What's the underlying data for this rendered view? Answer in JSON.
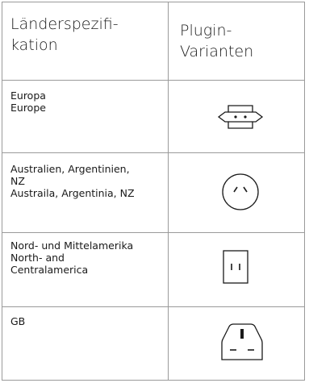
{
  "header": {
    "col1": "Länderspezifi-\nkation",
    "col2": "Plugin-\nVarianten"
  },
  "rows": [
    {
      "region": "Europa\nEurope",
      "icon": "europlug-icon"
    },
    {
      "region": "Australien, Argentinien,\nNZ\nAustraila, Argentinia, NZ",
      "icon": "au-plug-icon"
    },
    {
      "region": "Nord- und Mittelamerika\nNorth- and\nCentralamerica",
      "icon": "us-plug-icon"
    },
    {
      "region": "GB",
      "icon": "uk-plug-icon"
    }
  ]
}
